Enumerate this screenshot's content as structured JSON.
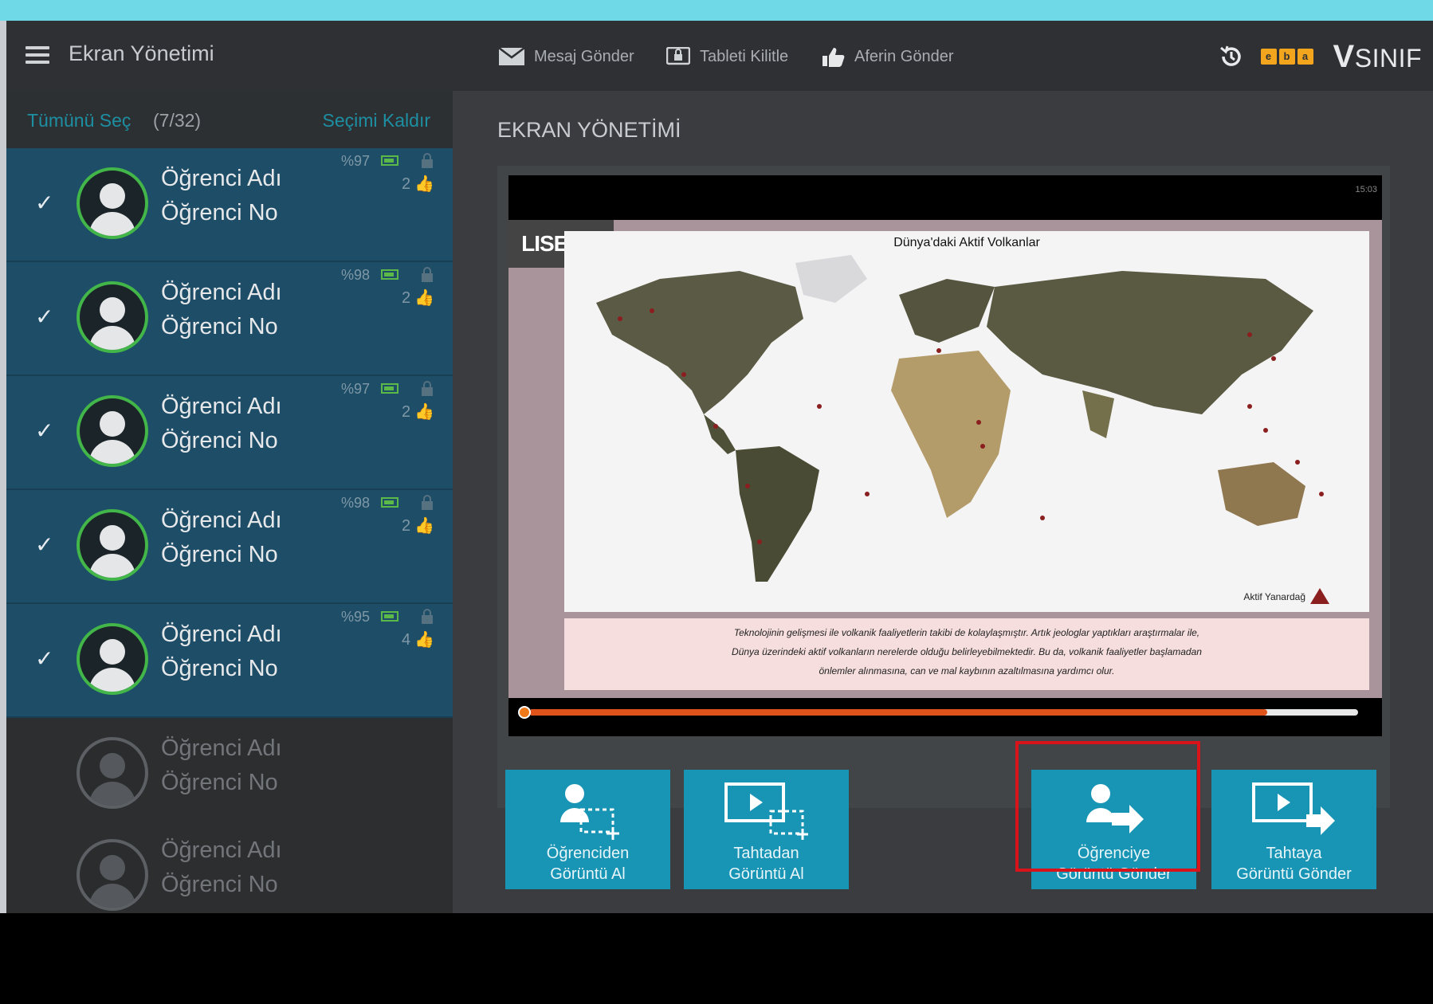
{
  "header": {
    "title": "Ekran Yönetimi",
    "actions": [
      "Mesaj Gönder",
      "Tableti Kilitle",
      "Aferin Gönder"
    ],
    "brand_eba": [
      "e",
      "b",
      "a"
    ],
    "brand_v": "V",
    "brand_name": "SINIF"
  },
  "sidebar": {
    "select_all": "Tümünü Seç",
    "count": "(7/32)",
    "deselect": "Seçimi Kaldır",
    "students": [
      {
        "name": "Öğrenci Adı",
        "no": "Öğrenci No",
        "battery": "%97",
        "likes": "2",
        "selected": true
      },
      {
        "name": "Öğrenci Adı",
        "no": "Öğrenci No",
        "battery": "%98",
        "likes": "2",
        "selected": true
      },
      {
        "name": "Öğrenci Adı",
        "no": "Öğrenci No",
        "battery": "%97",
        "likes": "2",
        "selected": true
      },
      {
        "name": "Öğrenci Adı",
        "no": "Öğrenci No",
        "battery": "%98",
        "likes": "2",
        "selected": true
      },
      {
        "name": "Öğrenci Adı",
        "no": "Öğrenci No",
        "battery": "%95",
        "likes": "4",
        "selected": true
      },
      {
        "name": "Öğrenci Adı",
        "no": "Öğrenci No",
        "selected": false
      },
      {
        "name": "Öğrenci Adı",
        "no": "Öğrenci No",
        "selected": false
      }
    ]
  },
  "main": {
    "title": "EKRAN YÖNETİMİ",
    "screen": {
      "status": "15:03",
      "brand": "LISEGO",
      "map_title": "Dünya'daki Aktif Volkanlar",
      "legend": "Aktif Yanardağ",
      "caption": [
        "Teknolojinin gelişmesi ile volkanik faaliyetlerin takibi de kolaylaşmıştır. Artık jeologlar yaptıkları araştırmalar ile,",
        "Dünya üzerindeki aktif volkanların nerelerde olduğu belirleyebilmektedir. Bu da, volkanik faaliyetler başlamadan",
        "önlemler alınmasına, can ve mal kaybının azaltılmasına yardımcı olur."
      ],
      "progress": 0.89
    },
    "buttons": [
      {
        "line1": "Öğrenciden",
        "line2": "Görüntü Al"
      },
      {
        "line1": "Tahtadan",
        "line2": "Görüntü Al"
      },
      {
        "line1": "Öğrenciye",
        "line2": "Görüntü Gönder"
      },
      {
        "line1": "Tahtaya",
        "line2": "Görüntü Gönder"
      }
    ]
  },
  "colors": {
    "accent": "#1894b5",
    "selected_row": "#1e4d68",
    "online_ring": "#42b649",
    "highlight": "#d8141a"
  }
}
